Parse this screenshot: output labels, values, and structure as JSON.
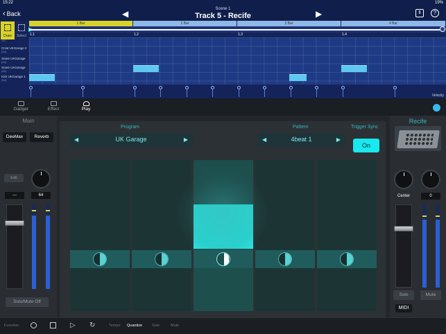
{
  "status": {
    "time": "15:22",
    "battery": "19%"
  },
  "nav": {
    "back_label": "Back",
    "scene": "Scene 1",
    "track": "Track 5 - Recife"
  },
  "tools": {
    "draw": "Draw",
    "select": "Select"
  },
  "bars": [
    "1 Bar",
    "2 Bar",
    "3 Bar",
    "4 Bar"
  ],
  "positions": [
    "1.1",
    "1.2",
    "1.3",
    "1.4"
  ],
  "lanes": [
    {
      "name": "",
      "sub": "433"
    },
    {
      "name": "CHat UKGarage 2",
      "sub": "[Dbl]"
    },
    {
      "name": "Snare UKGarage",
      "sub": "[Dbl]"
    },
    {
      "name": "Snare UKGarage",
      "sub": "[Dbl]"
    },
    {
      "name": "Kick UKGarage 1",
      "sub": "[Dbl]"
    }
  ],
  "velocity_label": "Velocity",
  "tabs": [
    "Gadget",
    "Effect",
    "Play"
  ],
  "left_panel": {
    "title": "Main",
    "fx": [
      "DeeMax",
      "Reverb"
    ],
    "edit": "Edit",
    "pan_value": "---",
    "vol_value": "64",
    "solo_mute_off": "Solo/Mute Off"
  },
  "center": {
    "program_label": "Program",
    "program_value": "UK Garage",
    "pattern_label": "Pattern",
    "pattern_value": "4beat 1",
    "trigger_label": "Trigger Sync",
    "trigger_value": "On",
    "prev_arrow": "◀",
    "next_arrow": "▶"
  },
  "right_panel": {
    "title": "Recife",
    "pan_value": "Center",
    "vol_value": "0",
    "solo": "Solo",
    "mute": "Mute",
    "midi": "MIDI"
  },
  "transport": {
    "function": "Function",
    "tempo": "Tempo",
    "quantize": "Quantize",
    "solo": "Solo",
    "mute": "Mute"
  },
  "colors": {
    "accent": "#19e8ee",
    "roll_bg": "#1e3a84",
    "bar_active": "#d8d22a"
  }
}
